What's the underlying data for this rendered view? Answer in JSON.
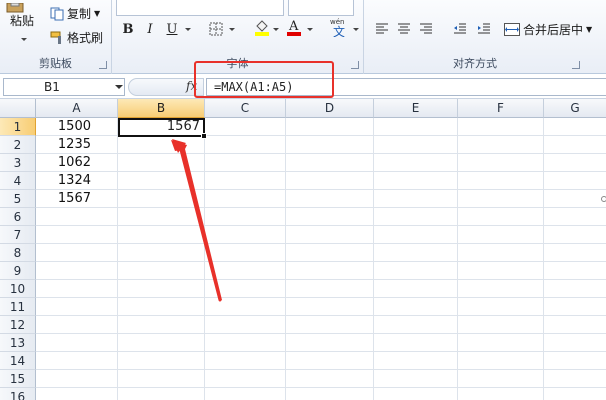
{
  "ribbon": {
    "clipboard": {
      "paste_label": "粘贴",
      "copy_label": "复制",
      "format_painter_label": "格式刷",
      "group_label": "剪贴板"
    },
    "font": {
      "group_label": "字体"
    },
    "alignment": {
      "group_label": "对齐方式",
      "merge_center_label": "合并后居中"
    }
  },
  "formula_bar": {
    "name_box": "B1",
    "fx_label": "fx",
    "formula": "=MAX(A1:A5)"
  },
  "sheet": {
    "columns": [
      "A",
      "B",
      "C",
      "D",
      "E",
      "F",
      "G"
    ],
    "rows": [
      "1",
      "2",
      "3",
      "4",
      "5",
      "6",
      "7",
      "8",
      "9",
      "10",
      "11",
      "12",
      "13",
      "14",
      "15",
      "16"
    ],
    "selected_column": "B",
    "selected_row": "1",
    "col_a_values": [
      "1500",
      "1235",
      "1062",
      "1324",
      "1567"
    ],
    "b1_value": "1567"
  },
  "colors": {
    "annotation_red": "#e8312a",
    "selected_header": "#f8cd74"
  }
}
